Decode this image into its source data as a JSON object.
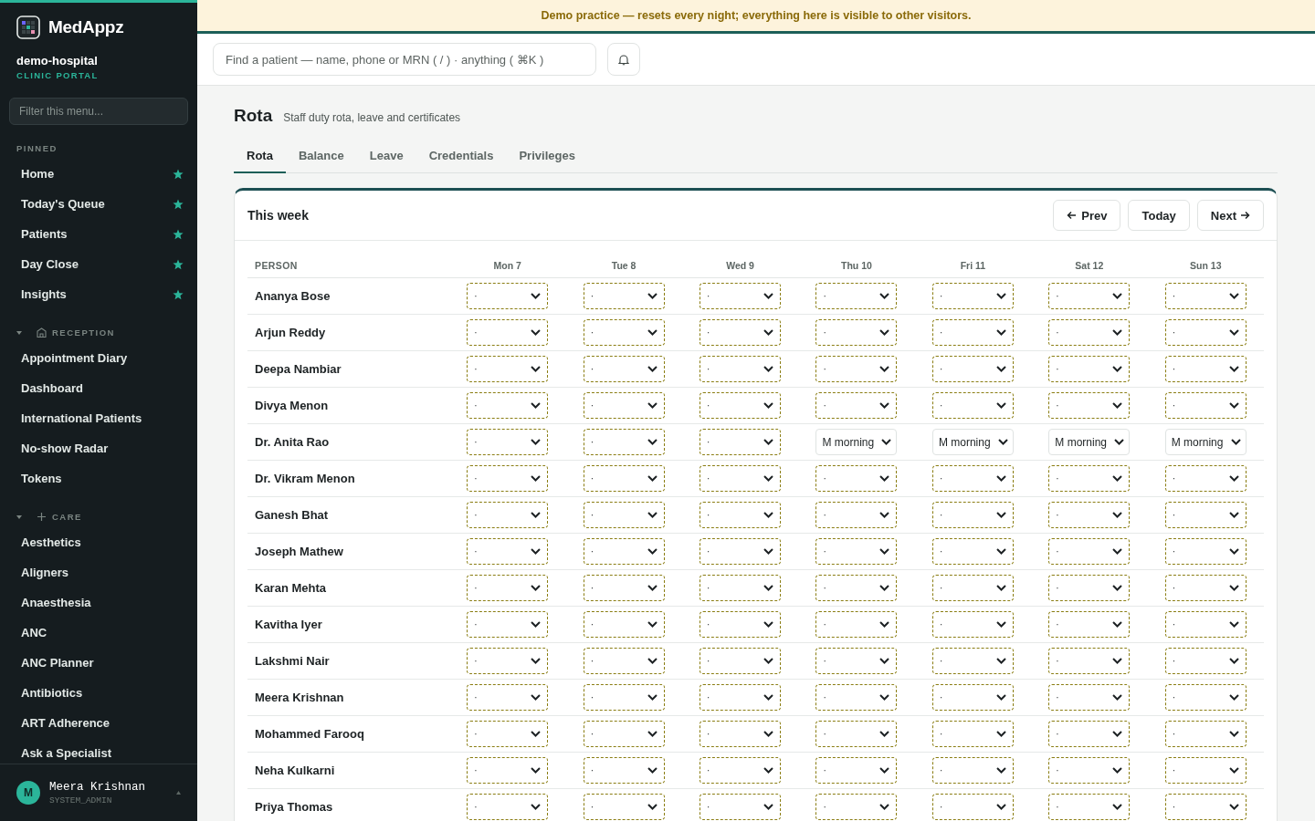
{
  "banner": {
    "text": "Demo practice — resets every night; everything here is visible to other visitors."
  },
  "sidebar": {
    "brand": "MedAppz",
    "org": "demo-hospital",
    "portal": "CLINIC PORTAL",
    "filter": {
      "placeholder": "Filter this menu..."
    },
    "sections": [
      {
        "label": "PINNED",
        "kind": "pinned",
        "items": [
          {
            "label": "Home",
            "pinned": true
          },
          {
            "label": "Today's Queue",
            "pinned": true
          },
          {
            "label": "Patients",
            "pinned": true
          },
          {
            "label": "Day Close",
            "pinned": true
          },
          {
            "label": "Insights",
            "pinned": true
          }
        ]
      },
      {
        "label": "RECEPTION",
        "kind": "building",
        "expanded": true,
        "items": [
          {
            "label": "Appointment Diary",
            "pinned": false
          },
          {
            "label": "Dashboard",
            "pinned": false
          },
          {
            "label": "International Patients",
            "pinned": false
          },
          {
            "label": "No-show Radar",
            "pinned": false
          },
          {
            "label": "Tokens",
            "pinned": false
          }
        ]
      },
      {
        "label": "CARE",
        "kind": "plus",
        "expanded": true,
        "items": [
          {
            "label": "Aesthetics",
            "pinned": false
          },
          {
            "label": "Aligners",
            "pinned": false
          },
          {
            "label": "Anaesthesia",
            "pinned": false
          },
          {
            "label": "ANC",
            "pinned": false
          },
          {
            "label": "ANC Planner",
            "pinned": false
          },
          {
            "label": "Antibiotics",
            "pinned": false
          },
          {
            "label": "ART Adherence",
            "pinned": false
          },
          {
            "label": "Ask a Specialist",
            "pinned": false
          }
        ]
      }
    ],
    "user": {
      "initial": "M",
      "name": "Meera Krishnan",
      "role": "SYSTEM_ADMIN"
    }
  },
  "search": {
    "placeholder": "Find a patient — name, phone or MRN ( / ) · anything ( ⌘K )"
  },
  "page": {
    "title": "Rota",
    "subtitle": "Staff duty rota, leave and certificates"
  },
  "tabs": [
    {
      "label": "Rota",
      "selected": true
    },
    {
      "label": "Balance",
      "selected": false
    },
    {
      "label": "Leave",
      "selected": false
    },
    {
      "label": "Credentials",
      "selected": false
    },
    {
      "label": "Privileges",
      "selected": false
    }
  ],
  "card": {
    "title": "This week",
    "buttons": [
      {
        "label": "Prev",
        "kind": "prev"
      },
      {
        "label": "Today",
        "kind": "plain"
      },
      {
        "label": "Next",
        "kind": "next"
      }
    ]
  },
  "table": {
    "person_column": "PERSON",
    "columns": [
      "Mon 7",
      "Tue 8",
      "Wed 9",
      "Thu 10",
      "Fri 11",
      "Sat 12",
      "Sun 13"
    ],
    "rows": [
      {
        "name": "Ananya Bose",
        "cells": [
          {
            "value": "·",
            "assigned": false
          },
          {
            "value": "·",
            "assigned": false
          },
          {
            "value": "·",
            "assigned": false
          },
          {
            "value": "·",
            "assigned": false
          },
          {
            "value": "·",
            "assigned": false
          },
          {
            "value": "·",
            "assigned": false
          },
          {
            "value": "·",
            "assigned": false
          }
        ]
      },
      {
        "name": "Arjun Reddy",
        "cells": [
          {
            "value": "·",
            "assigned": false
          },
          {
            "value": "·",
            "assigned": false
          },
          {
            "value": "·",
            "assigned": false
          },
          {
            "value": "·",
            "assigned": false
          },
          {
            "value": "·",
            "assigned": false
          },
          {
            "value": "·",
            "assigned": false
          },
          {
            "value": "·",
            "assigned": false
          }
        ]
      },
      {
        "name": "Deepa Nambiar",
        "cells": [
          {
            "value": "·",
            "assigned": false
          },
          {
            "value": "·",
            "assigned": false
          },
          {
            "value": "·",
            "assigned": false
          },
          {
            "value": "·",
            "assigned": false
          },
          {
            "value": "·",
            "assigned": false
          },
          {
            "value": "·",
            "assigned": false
          },
          {
            "value": "·",
            "assigned": false
          }
        ]
      },
      {
        "name": "Divya Menon",
        "cells": [
          {
            "value": "·",
            "assigned": false
          },
          {
            "value": "·",
            "assigned": false
          },
          {
            "value": "·",
            "assigned": false
          },
          {
            "value": "·",
            "assigned": false
          },
          {
            "value": "·",
            "assigned": false
          },
          {
            "value": "·",
            "assigned": false
          },
          {
            "value": "·",
            "assigned": false
          }
        ]
      },
      {
        "name": "Dr. Anita Rao",
        "cells": [
          {
            "value": "·",
            "assigned": false
          },
          {
            "value": "·",
            "assigned": false
          },
          {
            "value": "·",
            "assigned": false
          },
          {
            "value": "M morning",
            "assigned": true
          },
          {
            "value": "M morning",
            "assigned": true
          },
          {
            "value": "M morning",
            "assigned": true
          },
          {
            "value": "M morning",
            "assigned": true
          }
        ]
      },
      {
        "name": "Dr. Vikram Menon",
        "cells": [
          {
            "value": "·",
            "assigned": false
          },
          {
            "value": "·",
            "assigned": false
          },
          {
            "value": "·",
            "assigned": false
          },
          {
            "value": "·",
            "assigned": false
          },
          {
            "value": "·",
            "assigned": false
          },
          {
            "value": "·",
            "assigned": false
          },
          {
            "value": "·",
            "assigned": false
          }
        ]
      },
      {
        "name": "Ganesh Bhat",
        "cells": [
          {
            "value": "·",
            "assigned": false
          },
          {
            "value": "·",
            "assigned": false
          },
          {
            "value": "·",
            "assigned": false
          },
          {
            "value": "·",
            "assigned": false
          },
          {
            "value": "·",
            "assigned": false
          },
          {
            "value": "·",
            "assigned": false
          },
          {
            "value": "·",
            "assigned": false
          }
        ]
      },
      {
        "name": "Joseph Mathew",
        "cells": [
          {
            "value": "·",
            "assigned": false
          },
          {
            "value": "·",
            "assigned": false
          },
          {
            "value": "·",
            "assigned": false
          },
          {
            "value": "·",
            "assigned": false
          },
          {
            "value": "·",
            "assigned": false
          },
          {
            "value": "·",
            "assigned": false
          },
          {
            "value": "·",
            "assigned": false
          }
        ]
      },
      {
        "name": "Karan Mehta",
        "cells": [
          {
            "value": "·",
            "assigned": false
          },
          {
            "value": "·",
            "assigned": false
          },
          {
            "value": "·",
            "assigned": false
          },
          {
            "value": "·",
            "assigned": false
          },
          {
            "value": "·",
            "assigned": false
          },
          {
            "value": "·",
            "assigned": false
          },
          {
            "value": "·",
            "assigned": false
          }
        ]
      },
      {
        "name": "Kavitha Iyer",
        "cells": [
          {
            "value": "·",
            "assigned": false
          },
          {
            "value": "·",
            "assigned": false
          },
          {
            "value": "·",
            "assigned": false
          },
          {
            "value": "·",
            "assigned": false
          },
          {
            "value": "·",
            "assigned": false
          },
          {
            "value": "·",
            "assigned": false
          },
          {
            "value": "·",
            "assigned": false
          }
        ]
      },
      {
        "name": "Lakshmi Nair",
        "cells": [
          {
            "value": "·",
            "assigned": false
          },
          {
            "value": "·",
            "assigned": false
          },
          {
            "value": "·",
            "assigned": false
          },
          {
            "value": "·",
            "assigned": false
          },
          {
            "value": "·",
            "assigned": false
          },
          {
            "value": "·",
            "assigned": false
          },
          {
            "value": "·",
            "assigned": false
          }
        ]
      },
      {
        "name": "Meera Krishnan",
        "cells": [
          {
            "value": "·",
            "assigned": false
          },
          {
            "value": "·",
            "assigned": false
          },
          {
            "value": "·",
            "assigned": false
          },
          {
            "value": "·",
            "assigned": false
          },
          {
            "value": "·",
            "assigned": false
          },
          {
            "value": "·",
            "assigned": false
          },
          {
            "value": "·",
            "assigned": false
          }
        ]
      },
      {
        "name": "Mohammed Farooq",
        "cells": [
          {
            "value": "·",
            "assigned": false
          },
          {
            "value": "·",
            "assigned": false
          },
          {
            "value": "·",
            "assigned": false
          },
          {
            "value": "·",
            "assigned": false
          },
          {
            "value": "·",
            "assigned": false
          },
          {
            "value": "·",
            "assigned": false
          },
          {
            "value": "·",
            "assigned": false
          }
        ]
      },
      {
        "name": "Neha Kulkarni",
        "cells": [
          {
            "value": "·",
            "assigned": false
          },
          {
            "value": "·",
            "assigned": false
          },
          {
            "value": "·",
            "assigned": false
          },
          {
            "value": "·",
            "assigned": false
          },
          {
            "value": "·",
            "assigned": false
          },
          {
            "value": "·",
            "assigned": false
          },
          {
            "value": "·",
            "assigned": false
          }
        ]
      },
      {
        "name": "Priya Thomas",
        "cells": [
          {
            "value": "·",
            "assigned": false
          },
          {
            "value": "·",
            "assigned": false
          },
          {
            "value": "·",
            "assigned": false
          },
          {
            "value": "·",
            "assigned": false
          },
          {
            "value": "·",
            "assigned": false
          },
          {
            "value": "·",
            "assigned": false
          },
          {
            "value": "·",
            "assigned": false
          }
        ]
      }
    ]
  }
}
